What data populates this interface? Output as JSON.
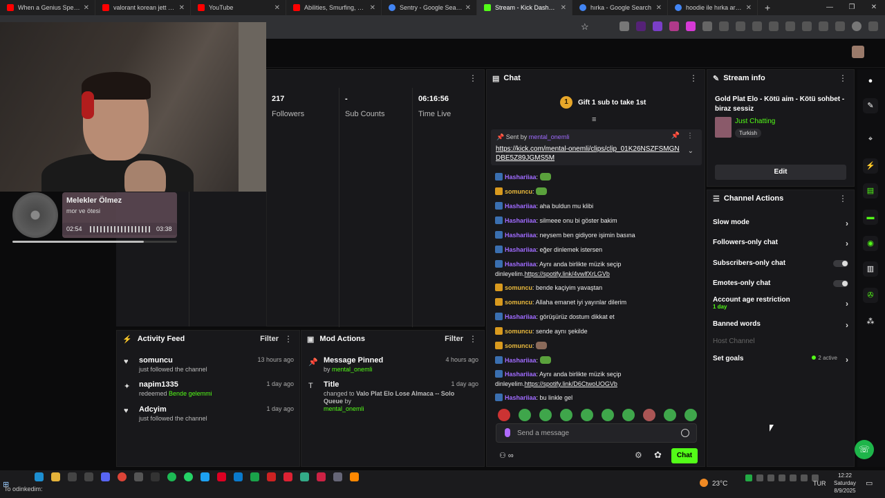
{
  "browser": {
    "tabs": [
      {
        "title": "When a Genius Spearmar",
        "color": "#ff0000",
        "active": false
      },
      {
        "title": "valorant korean jett seold",
        "color": "#ff0000",
        "active": false
      },
      {
        "title": "YouTube",
        "color": "#ff0000",
        "active": false
      },
      {
        "title": "Abilities, Smurfing, Replay",
        "color": "#ff0000",
        "active": false
      },
      {
        "title": "Sentry - Google Search",
        "color": "#4285f4",
        "active": false
      },
      {
        "title": "Stream - Kick Dashboard",
        "color": "#53fc18",
        "active": true
      },
      {
        "title": "hırka - Google Search",
        "color": "#4285f4",
        "active": false
      },
      {
        "title": "hoodie ile hırka arasındak",
        "color": "#4285f4",
        "active": false
      }
    ],
    "new_tab": "+"
  },
  "music": {
    "song": "Melekler Ölmez",
    "artist": "mor ve ötesi",
    "elapsed": "02:54",
    "total": "03:38",
    "progress": 0.8
  },
  "stats": {
    "followers_value": "217",
    "followers_label": "Followers",
    "subs_value": "-",
    "subs_label": "Sub Counts",
    "time_value": "06:16:56",
    "time_label": "Time Live"
  },
  "activity": {
    "title": "Activity Feed",
    "filter": "Filter",
    "items": [
      {
        "name": "somuncu",
        "time": "13 hours ago",
        "sub": "just followed the channel",
        "reward": ""
      },
      {
        "name": "napim1335",
        "time": "1 day ago",
        "sub": "redeemed",
        "reward": "Bende gelemmi"
      },
      {
        "name": "Adcyim",
        "time": "1 day ago",
        "sub": "just followed the channel",
        "reward": ""
      }
    ]
  },
  "mod": {
    "title": "Mod Actions",
    "filter": "Filter",
    "items": [
      {
        "name": "Message Pinned",
        "time": "4 hours ago",
        "by_prefix": "by",
        "by_user": "mental_onemli",
        "changed": ""
      },
      {
        "name": "Title",
        "time": "1 day ago",
        "changed": "changed to",
        "new_title": "Valo Plat Elo Lose Almaca -- Solo Queue",
        "by_prefix": "by",
        "by_user": "mental_onemli"
      }
    ]
  },
  "chat": {
    "title": "Chat",
    "gift": "Gift 1 sub to take 1st",
    "gift_rank": "1",
    "pinned_sent_by": "Sent by",
    "pinned_user": "mental_onemli",
    "pinned_link": "https://kick.com/mental-onemli/clips/clip_01K26NSZFSMGNDBE5Z89JGMS5M",
    "messages": [
      {
        "user": "Hashariiaa",
        "text": "",
        "emote": true,
        "kind": "blue"
      },
      {
        "user": "somuncu",
        "text": "",
        "emote": true,
        "kind": "gold"
      },
      {
        "user": "Hashariiaa",
        "text": "aha buldun mu klibi",
        "kind": "blue"
      },
      {
        "user": "Hashariiaa",
        "text": "silmeee onu bi göster bakim",
        "kind": "blue"
      },
      {
        "user": "Hashariiaa",
        "text": "neysem ben gidiyore işimin basına",
        "kind": "blue"
      },
      {
        "user": "Hashariiaa",
        "text": "eğer dinlemek istersen",
        "kind": "blue"
      },
      {
        "user": "Hashariiaa",
        "text": "Aynı anda birlikte müzik seçip dinleyelim.",
        "link": "https://spotify.link/4vwlfXrLGVb",
        "kind": "blue"
      },
      {
        "user": "somuncu",
        "text": "bende kaçiyim yavaştan",
        "kind": "gold"
      },
      {
        "user": "somuncu",
        "text": "Allaha emanet iyi yayınlar dilerim",
        "kind": "gold"
      },
      {
        "user": "Hashariiaa",
        "text": "görüşürüz dostum dikkat et",
        "kind": "blue"
      },
      {
        "user": "somuncu",
        "text": "sende aynı şekilde",
        "kind": "gold"
      },
      {
        "user": "somuncu",
        "text": "",
        "emote": true,
        "kind": "gold"
      },
      {
        "user": "Hashariiaa",
        "text": "",
        "emote": true,
        "kind": "blue"
      },
      {
        "user": "Hashariiaa",
        "text": "Aynı anda birlikte müzik seçip dinleyelim.",
        "link": "https://spotify.link/D6CtwoUOGVb",
        "kind": "blue"
      },
      {
        "user": "Hashariiaa",
        "text": "bu linkle gel",
        "kind": "blue"
      }
    ],
    "input_placeholder": "Send a message",
    "send_label": "Chat"
  },
  "stream_info": {
    "title": "Stream info",
    "stream_title": "Gold Plat Elo - Kötü aim - Kötü sohbet - biraz sessiz",
    "category": "Just Chatting",
    "language": "Turkish",
    "edit": "Edit"
  },
  "channel_actions": {
    "title": "Channel Actions",
    "slow": "Slow mode",
    "followers_only": "Followers-only chat",
    "subs_only": "Subscribers-only chat",
    "emotes_only": "Emotes-only chat",
    "account_age": "Account age restriction",
    "account_age_value": "1 day",
    "banned": "Banned words",
    "host": "Host Channel",
    "goals": "Set goals",
    "goals_active": "2 active"
  },
  "taskbar": {
    "search_text": "To odinkedim:",
    "temp": "23°C",
    "lang": "TUR",
    "time": "12:22",
    "day": "Saturday",
    "date": "8/9/2025"
  }
}
